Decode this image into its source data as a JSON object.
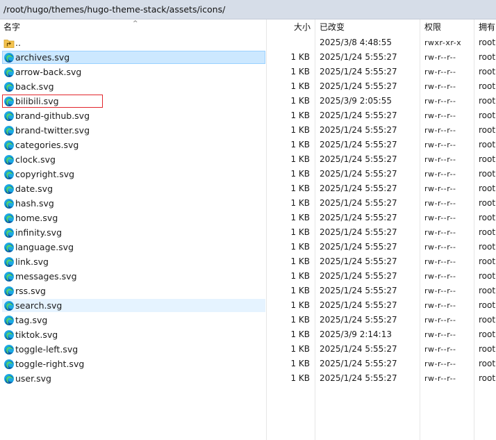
{
  "path": "/root/hugo/themes/hugo-theme-stack/assets/icons/",
  "columns": {
    "name": "名字",
    "size": "大小",
    "modified": "已改变",
    "perms": "权限",
    "owner": "拥有"
  },
  "files": [
    {
      "name": "..",
      "size": "",
      "date": "2025/3/8 4:48:55",
      "perm": "rwxr-xr-x",
      "owner": "root",
      "icon": "folder-up-icon"
    },
    {
      "name": "archives.svg",
      "size": "1 KB",
      "date": "2025/1/24 5:55:27",
      "perm": "rw-r--r--",
      "owner": "root",
      "icon": "edge-file-icon",
      "state": "selected"
    },
    {
      "name": "arrow-back.svg",
      "size": "1 KB",
      "date": "2025/1/24 5:55:27",
      "perm": "rw-r--r--",
      "owner": "root",
      "icon": "edge-file-icon"
    },
    {
      "name": "back.svg",
      "size": "1 KB",
      "date": "2025/1/24 5:55:27",
      "perm": "rw-r--r--",
      "owner": "root",
      "icon": "edge-file-icon"
    },
    {
      "name": "bilibili.svg",
      "size": "1 KB",
      "date": "2025/3/9 2:05:55",
      "perm": "rw-r--r--",
      "owner": "root",
      "icon": "edge-file-icon",
      "state": "boxed"
    },
    {
      "name": "brand-github.svg",
      "size": "1 KB",
      "date": "2025/1/24 5:55:27",
      "perm": "rw-r--r--",
      "owner": "root",
      "icon": "edge-file-icon"
    },
    {
      "name": "brand-twitter.svg",
      "size": "1 KB",
      "date": "2025/1/24 5:55:27",
      "perm": "rw-r--r--",
      "owner": "root",
      "icon": "edge-file-icon"
    },
    {
      "name": "categories.svg",
      "size": "1 KB",
      "date": "2025/1/24 5:55:27",
      "perm": "rw-r--r--",
      "owner": "root",
      "icon": "edge-file-icon"
    },
    {
      "name": "clock.svg",
      "size": "1 KB",
      "date": "2025/1/24 5:55:27",
      "perm": "rw-r--r--",
      "owner": "root",
      "icon": "edge-file-icon"
    },
    {
      "name": "copyright.svg",
      "size": "1 KB",
      "date": "2025/1/24 5:55:27",
      "perm": "rw-r--r--",
      "owner": "root",
      "icon": "edge-file-icon"
    },
    {
      "name": "date.svg",
      "size": "1 KB",
      "date": "2025/1/24 5:55:27",
      "perm": "rw-r--r--",
      "owner": "root",
      "icon": "edge-file-icon"
    },
    {
      "name": "hash.svg",
      "size": "1 KB",
      "date": "2025/1/24 5:55:27",
      "perm": "rw-r--r--",
      "owner": "root",
      "icon": "edge-file-icon"
    },
    {
      "name": "home.svg",
      "size": "1 KB",
      "date": "2025/1/24 5:55:27",
      "perm": "rw-r--r--",
      "owner": "root",
      "icon": "edge-file-icon"
    },
    {
      "name": "infinity.svg",
      "size": "1 KB",
      "date": "2025/1/24 5:55:27",
      "perm": "rw-r--r--",
      "owner": "root",
      "icon": "edge-file-icon"
    },
    {
      "name": "language.svg",
      "size": "1 KB",
      "date": "2025/1/24 5:55:27",
      "perm": "rw-r--r--",
      "owner": "root",
      "icon": "edge-file-icon"
    },
    {
      "name": "link.svg",
      "size": "1 KB",
      "date": "2025/1/24 5:55:27",
      "perm": "rw-r--r--",
      "owner": "root",
      "icon": "edge-file-icon"
    },
    {
      "name": "messages.svg",
      "size": "1 KB",
      "date": "2025/1/24 5:55:27",
      "perm": "rw-r--r--",
      "owner": "root",
      "icon": "edge-file-icon"
    },
    {
      "name": "rss.svg",
      "size": "1 KB",
      "date": "2025/1/24 5:55:27",
      "perm": "rw-r--r--",
      "owner": "root",
      "icon": "edge-file-icon"
    },
    {
      "name": "search.svg",
      "size": "1 KB",
      "date": "2025/1/24 5:55:27",
      "perm": "rw-r--r--",
      "owner": "root",
      "icon": "edge-file-icon",
      "state": "hover"
    },
    {
      "name": "tag.svg",
      "size": "1 KB",
      "date": "2025/1/24 5:55:27",
      "perm": "rw-r--r--",
      "owner": "root",
      "icon": "edge-file-icon"
    },
    {
      "name": "tiktok.svg",
      "size": "1 KB",
      "date": "2025/3/9 2:14:13",
      "perm": "rw-r--r--",
      "owner": "root",
      "icon": "edge-file-icon"
    },
    {
      "name": "toggle-left.svg",
      "size": "1 KB",
      "date": "2025/1/24 5:55:27",
      "perm": "rw-r--r--",
      "owner": "root",
      "icon": "edge-file-icon"
    },
    {
      "name": "toggle-right.svg",
      "size": "1 KB",
      "date": "2025/1/24 5:55:27",
      "perm": "rw-r--r--",
      "owner": "root",
      "icon": "edge-file-icon"
    },
    {
      "name": "user.svg",
      "size": "1 KB",
      "date": "2025/1/24 5:55:27",
      "perm": "rw-r--r--",
      "owner": "root",
      "icon": "edge-file-icon"
    }
  ],
  "colors": {
    "path_bar": "#d6dde8",
    "selection": "#cce8ff",
    "hover": "#e5f3ff",
    "boxed_outline": "#e2242b"
  }
}
